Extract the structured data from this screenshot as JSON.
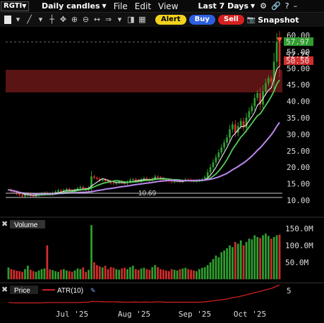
{
  "symbol": "RGTI",
  "interval": "Daily candles",
  "menu": [
    "File",
    "Edit",
    "View"
  ],
  "range": "Last 7 Days",
  "buttons": {
    "alert": "Alert",
    "buy": "Buy",
    "sell": "Sell",
    "snapshot": "Snapshot"
  },
  "colors": {
    "up": "#2f9e2f",
    "down": "#d12d2d",
    "ma_short": "#ffffff",
    "ma_mid": "#55cc55",
    "ma_long": "#bb88ee",
    "resistance_band": "#5a1414",
    "atr": "#d02020"
  },
  "price_axis": [
    "60.00",
    "55.00",
    "50.00",
    "45.00",
    "40.00",
    "35.00",
    "30.00",
    "25.00",
    "20.00",
    "15.00",
    "10.00"
  ],
  "price_tags": {
    "last": "57.97",
    "mid": "52.25",
    "low": "50.50"
  },
  "line_label": "10.69",
  "volume_panel": {
    "title": "Volume",
    "axis": [
      "150.0M",
      "100.0M",
      "50.0M"
    ]
  },
  "atr_panel": {
    "tab_price": "Price",
    "tab_atr": "ATR(10)",
    "axis": "5"
  },
  "x_axis": [
    "Jul '25",
    "Aug '25",
    "Sep '25",
    "Oct '25"
  ],
  "chart_data": {
    "type": "candlestick",
    "ylim": [
      8,
      62
    ],
    "closes": [
      13.2,
      12.8,
      12.5,
      12.0,
      11.6,
      11.2,
      11.6,
      11.9,
      11.4,
      11.2,
      11.5,
      11.8,
      12.1,
      12.3,
      12.0,
      11.8,
      12.2,
      12.6,
      13.0,
      12.7,
      13.1,
      13.4,
      13.0,
      12.8,
      13.2,
      13.6,
      14.0,
      13.5,
      13.2,
      13.8,
      17.2,
      16.8,
      16.5,
      16.0,
      16.3,
      15.9,
      15.6,
      15.2,
      15.0,
      15.3,
      15.7,
      15.4,
      15.1,
      15.6,
      16.2,
      16.4,
      16.1,
      15.8,
      16.3,
      16.7,
      16.4,
      16.0,
      16.5,
      17.2,
      16.9,
      16.5,
      16.3,
      16.0,
      15.8,
      15.5,
      15.7,
      15.9,
      15.6,
      15.9,
      16.3,
      16.2,
      15.9,
      15.7,
      15.9,
      16.1,
      16.4,
      17.0,
      18.5,
      20.0,
      21.5,
      23.0,
      24.5,
      26.0,
      27.5,
      29.0,
      31.5,
      33.0,
      30.5,
      32.5,
      34.0,
      32.0,
      35.0,
      37.0,
      38.5,
      41.0,
      42.5,
      39.0,
      43.0,
      45.5,
      47.0,
      46.0,
      52.0,
      57.97,
      50.5
    ],
    "volume_m": [
      35,
      30,
      28,
      25,
      24,
      22,
      30,
      40,
      28,
      24,
      22,
      26,
      30,
      32,
      100,
      29,
      27,
      24,
      22,
      28,
      30,
      26,
      24,
      22,
      26,
      32,
      30,
      35,
      22,
      28,
      160,
      50,
      42,
      38,
      35,
      40,
      30,
      36,
      34,
      30,
      28,
      32,
      34,
      30,
      36,
      40,
      30,
      28,
      32,
      34,
      30,
      28,
      36,
      42,
      36,
      30,
      28,
      26,
      24,
      30,
      28,
      26,
      30,
      32,
      34,
      30,
      28,
      26,
      24,
      30,
      34,
      36,
      42,
      50,
      60,
      70,
      65,
      80,
      85,
      92,
      100,
      95,
      110,
      105,
      115,
      100,
      110,
      120,
      118,
      130,
      125,
      122,
      130,
      135,
      128,
      120,
      125,
      130,
      132
    ],
    "atr": [
      1.0,
      1.0,
      0.9,
      0.9,
      0.9,
      0.9,
      0.9,
      0.9,
      0.9,
      0.9,
      0.9,
      0.9,
      0.9,
      0.95,
      1.0,
      1.0,
      1.0,
      1.0,
      1.0,
      1.0,
      1.0,
      1.0,
      1.0,
      1.0,
      1.0,
      1.0,
      1.05,
      1.1,
      1.1,
      1.1,
      1.3,
      1.3,
      1.3,
      1.3,
      1.25,
      1.2,
      1.2,
      1.2,
      1.2,
      1.2,
      1.15,
      1.15,
      1.1,
      1.1,
      1.1,
      1.15,
      1.15,
      1.1,
      1.1,
      1.15,
      1.15,
      1.1,
      1.1,
      1.2,
      1.2,
      1.2,
      1.15,
      1.1,
      1.1,
      1.1,
      1.1,
      1.1,
      1.1,
      1.1,
      1.1,
      1.1,
      1.1,
      1.1,
      1.1,
      1.1,
      1.15,
      1.2,
      1.3,
      1.4,
      1.5,
      1.6,
      1.7,
      1.8,
      1.9,
      2.0,
      2.2,
      2.4,
      2.5,
      2.6,
      2.8,
      3.0,
      3.2,
      3.4,
      3.6,
      3.8,
      4.0,
      4.2,
      4.4,
      4.6,
      4.8,
      5.0,
      5.3,
      5.7,
      6.0
    ]
  }
}
